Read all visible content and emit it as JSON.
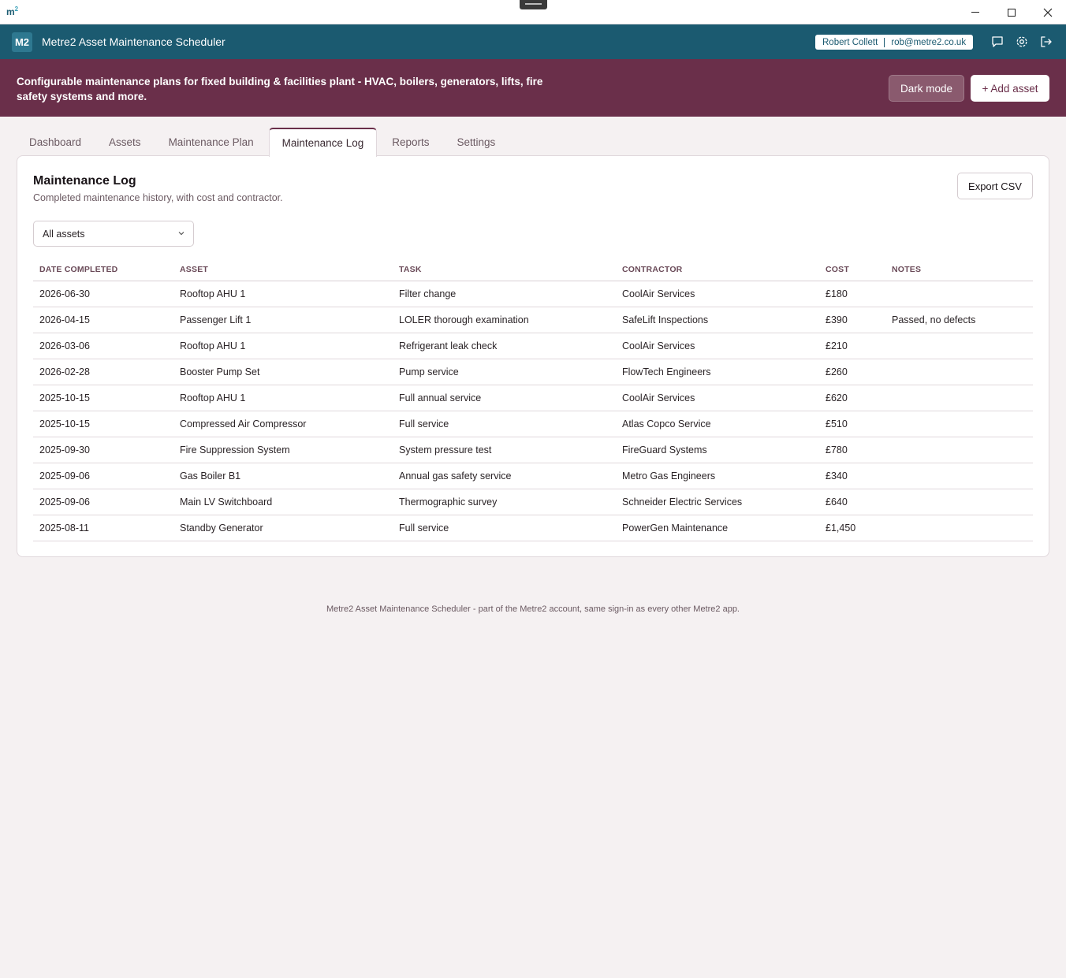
{
  "window": {
    "logo": "m",
    "logo_sup": "2"
  },
  "appbar": {
    "badge": "M2",
    "title": "Metre2 Asset Maintenance Scheduler",
    "user_name": "Robert Collett",
    "user_email": "rob@metre2.co.uk"
  },
  "banner": {
    "text": "Configurable maintenance plans for fixed building & facilities plant - HVAC, boilers, generators, lifts, fire safety systems and more.",
    "dark_mode_label": "Dark mode",
    "add_asset_label": "+ Add asset"
  },
  "tabs": [
    {
      "label": "Dashboard"
    },
    {
      "label": "Assets"
    },
    {
      "label": "Maintenance Plan"
    },
    {
      "label": "Maintenance Log"
    },
    {
      "label": "Reports"
    },
    {
      "label": "Settings"
    }
  ],
  "log": {
    "title": "Maintenance Log",
    "subtitle": "Completed maintenance history, with cost and contractor.",
    "export_label": "Export CSV",
    "filter_value": "All assets",
    "columns": [
      "Date completed",
      "Asset",
      "Task",
      "Contractor",
      "Cost",
      "Notes"
    ],
    "rows": [
      [
        "2026-06-30",
        "Rooftop AHU 1",
        "Filter change",
        "CoolAir Services",
        "£180",
        ""
      ],
      [
        "2026-04-15",
        "Passenger Lift 1",
        "LOLER thorough examination",
        "SafeLift Inspections",
        "£390",
        "Passed, no defects"
      ],
      [
        "2026-03-06",
        "Rooftop AHU 1",
        "Refrigerant leak check",
        "CoolAir Services",
        "£210",
        ""
      ],
      [
        "2026-02-28",
        "Booster Pump Set",
        "Pump service",
        "FlowTech Engineers",
        "£260",
        ""
      ],
      [
        "2025-10-15",
        "Rooftop AHU 1",
        "Full annual service",
        "CoolAir Services",
        "£620",
        ""
      ],
      [
        "2025-10-15",
        "Compressed Air Compressor",
        "Full service",
        "Atlas Copco Service",
        "£510",
        ""
      ],
      [
        "2025-09-30",
        "Fire Suppression System",
        "System pressure test",
        "FireGuard Systems",
        "£780",
        ""
      ],
      [
        "2025-09-06",
        "Gas Boiler B1",
        "Annual gas safety service",
        "Metro Gas Engineers",
        "£340",
        ""
      ],
      [
        "2025-09-06",
        "Main LV Switchboard",
        "Thermographic survey",
        "Schneider Electric Services",
        "£640",
        ""
      ],
      [
        "2025-08-11",
        "Standby Generator",
        "Full service",
        "PowerGen Maintenance",
        "£1,450",
        ""
      ]
    ]
  },
  "footer": {
    "text": "Metre2 Asset Maintenance Scheduler - part of the Metre2 account, same sign-in as every other Metre2 app."
  },
  "colors": {
    "appbar": "#1b5a70",
    "banner": "#6a2f4a",
    "background": "#f5f1f2"
  }
}
